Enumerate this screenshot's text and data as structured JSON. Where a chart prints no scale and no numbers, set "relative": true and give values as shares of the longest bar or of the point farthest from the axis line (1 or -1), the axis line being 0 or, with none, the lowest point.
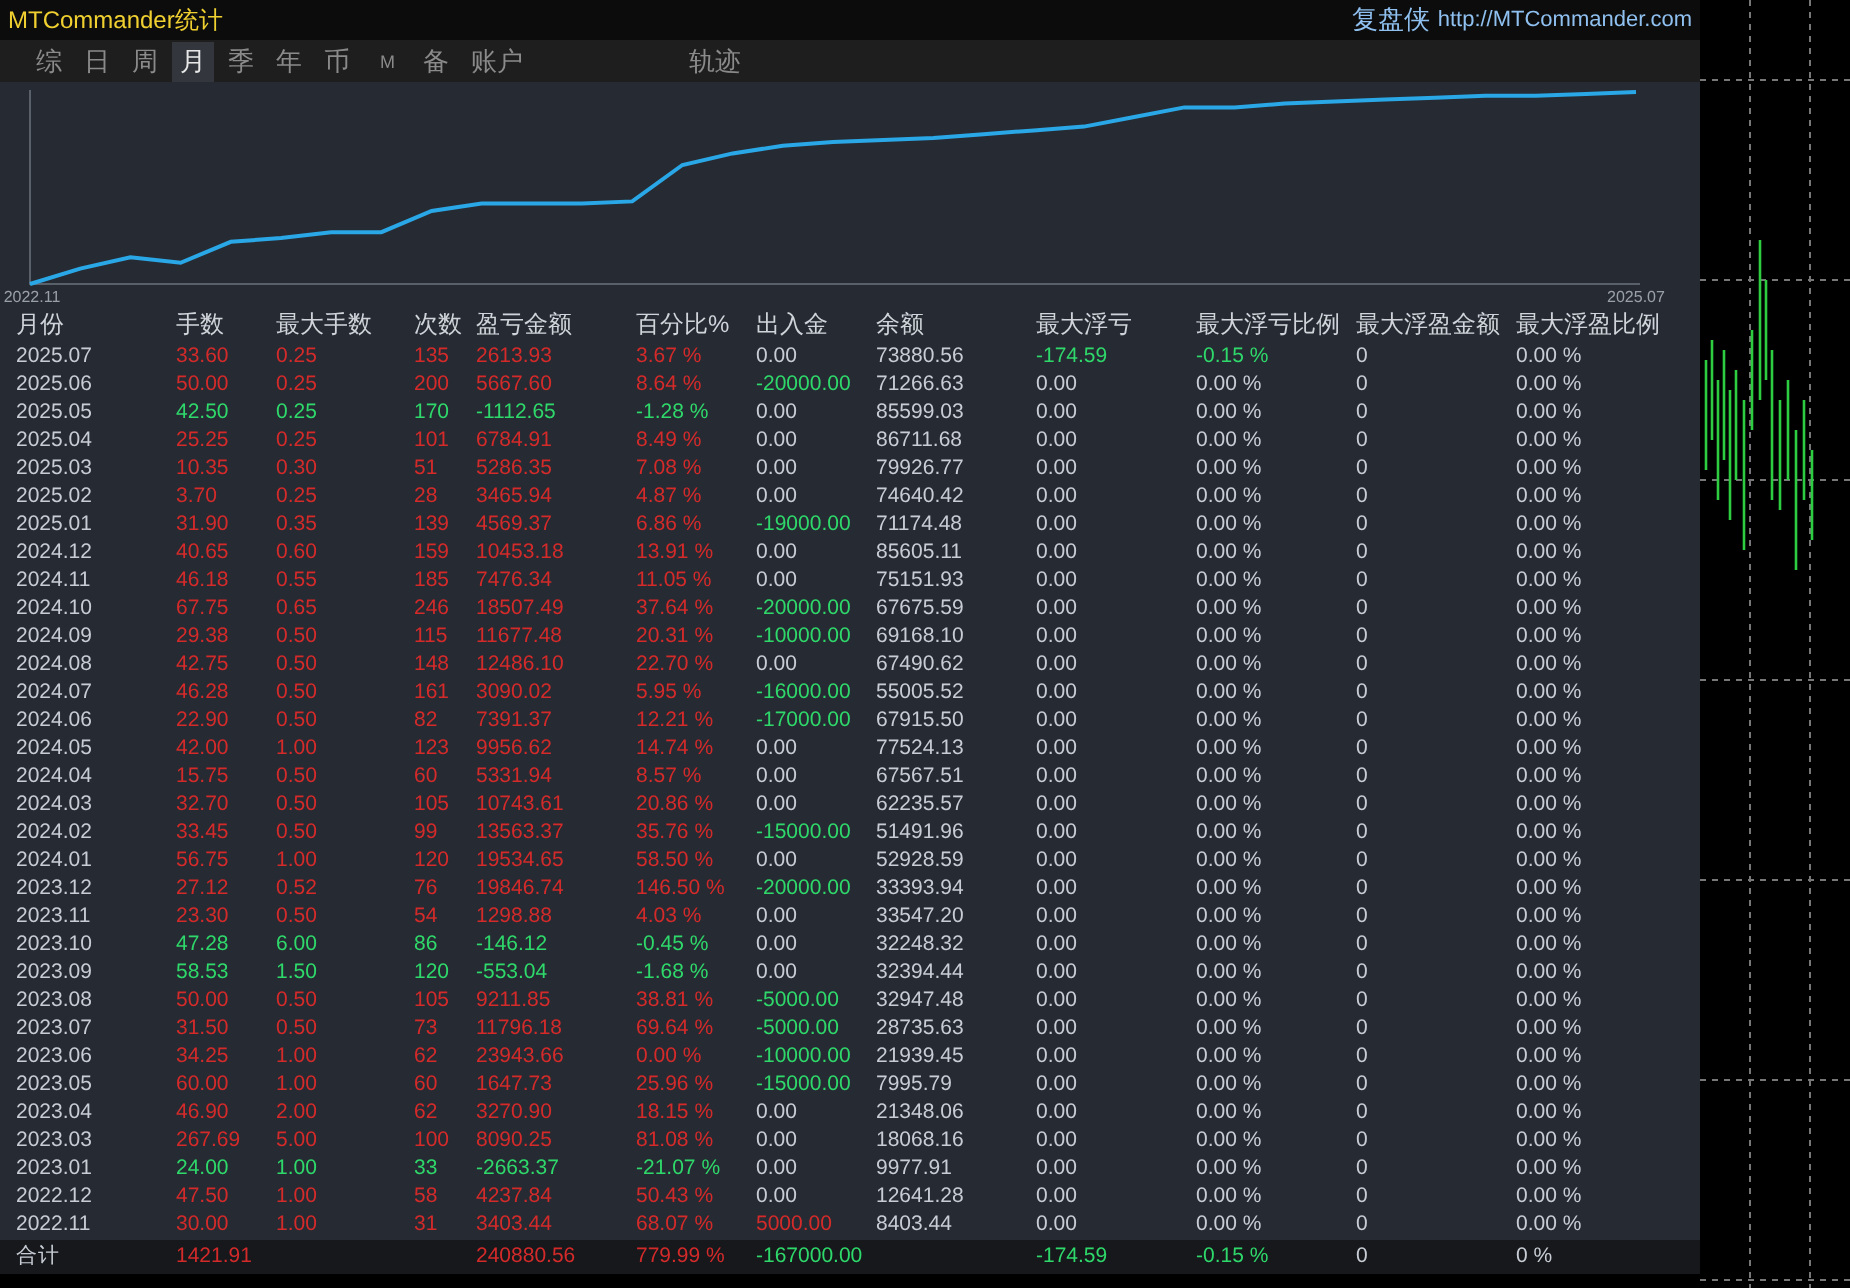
{
  "window": {
    "title": "MTCommander统计",
    "brand": "复盘侠",
    "link": "http://MTCommander.com"
  },
  "tabs": [
    {
      "label": "综",
      "selected": false,
      "kind": "char"
    },
    {
      "label": "日",
      "selected": false,
      "kind": "char"
    },
    {
      "label": "周",
      "selected": false,
      "kind": "char"
    },
    {
      "label": "月",
      "selected": true,
      "kind": "char"
    },
    {
      "label": "季",
      "selected": false,
      "kind": "char"
    },
    {
      "label": "年",
      "selected": false,
      "kind": "char"
    },
    {
      "label": "币",
      "selected": false,
      "kind": "char"
    },
    {
      "label": "M",
      "selected": false,
      "kind": "small"
    },
    {
      "label": "备",
      "selected": false,
      "kind": "char"
    },
    {
      "label": "账户",
      "selected": false,
      "kind": "char"
    },
    {
      "label": "轨迹",
      "selected": false,
      "kind": "far"
    }
  ],
  "equity_chart": {
    "chart_data": {
      "type": "line",
      "relative": true,
      "categories": [
        "2022.11",
        null,
        null,
        null,
        null,
        null,
        null,
        null,
        null,
        null,
        null,
        null,
        null,
        null,
        null,
        null,
        null,
        null,
        null,
        null,
        null,
        null,
        null,
        null,
        null,
        null,
        null,
        null,
        null,
        null,
        null,
        null,
        "2025.07"
      ],
      "series": [
        {
          "color": "#2aa7e6",
          "values": [
            0.0,
            0.08,
            0.14,
            0.11,
            0.22,
            0.24,
            0.27,
            0.27,
            0.38,
            0.42,
            0.42,
            0.42,
            0.43,
            0.62,
            0.68,
            0.72,
            0.74,
            0.75,
            0.76,
            0.78,
            0.8,
            0.82,
            0.87,
            0.92,
            0.92,
            0.94,
            0.95,
            0.96,
            0.97,
            0.98,
            0.98,
            0.99,
            1.0
          ]
        }
      ]
    }
  },
  "table": {
    "columns": [
      "月份",
      "手数",
      "最大手数",
      "次数",
      "盈亏金额",
      "百分比%",
      "出入金",
      "余额",
      "最大浮亏",
      "最大浮亏比例",
      "最大浮盈金额",
      "最大浮盈比例"
    ],
    "rows": [
      {
        "month": "2025.07",
        "trade": {
          "lots": "33.60",
          "max_lots": "0.25",
          "count": "135",
          "pnl": "2613.93",
          "pct": "3.67 %",
          "color": "#d42a2a"
        },
        "flow": {
          "amount": "0.00",
          "color": "#c8ccd4"
        },
        "balance": "73880.56",
        "drawdown": {
          "amount": "-174.59",
          "pct": "-0.15 %",
          "color": "#2fd86a"
        },
        "max_profit": "0",
        "max_profit_pct": "0.00 %"
      },
      {
        "month": "2025.06",
        "trade": {
          "lots": "50.00",
          "max_lots": "0.25",
          "count": "200",
          "pnl": "5667.60",
          "pct": "8.64 %",
          "color": "#d42a2a"
        },
        "flow": {
          "amount": "-20000.00",
          "color": "#2fd86a"
        },
        "balance": "71266.63",
        "drawdown": {
          "amount": "0.00",
          "pct": "0.00 %",
          "color": "#c8ccd4"
        },
        "max_profit": "0",
        "max_profit_pct": "0.00 %"
      },
      {
        "month": "2025.05",
        "trade": {
          "lots": "42.50",
          "max_lots": "0.25",
          "count": "170",
          "pnl": "-1112.65",
          "pct": "-1.28 %",
          "color": "#2fd86a"
        },
        "flow": {
          "amount": "0.00",
          "color": "#c8ccd4"
        },
        "balance": "85599.03",
        "drawdown": {
          "amount": "0.00",
          "pct": "0.00 %",
          "color": "#c8ccd4"
        },
        "max_profit": "0",
        "max_profit_pct": "0.00 %"
      },
      {
        "month": "2025.04",
        "trade": {
          "lots": "25.25",
          "max_lots": "0.25",
          "count": "101",
          "pnl": "6784.91",
          "pct": "8.49 %",
          "color": "#d42a2a"
        },
        "flow": {
          "amount": "0.00",
          "color": "#c8ccd4"
        },
        "balance": "86711.68",
        "drawdown": {
          "amount": "0.00",
          "pct": "0.00 %",
          "color": "#c8ccd4"
        },
        "max_profit": "0",
        "max_profit_pct": "0.00 %"
      },
      {
        "month": "2025.03",
        "trade": {
          "lots": "10.35",
          "max_lots": "0.30",
          "count": "51",
          "pnl": "5286.35",
          "pct": "7.08 %",
          "color": "#d42a2a"
        },
        "flow": {
          "amount": "0.00",
          "color": "#c8ccd4"
        },
        "balance": "79926.77",
        "drawdown": {
          "amount": "0.00",
          "pct": "0.00 %",
          "color": "#c8ccd4"
        },
        "max_profit": "0",
        "max_profit_pct": "0.00 %"
      },
      {
        "month": "2025.02",
        "trade": {
          "lots": "3.70",
          "max_lots": "0.25",
          "count": "28",
          "pnl": "3465.94",
          "pct": "4.87 %",
          "color": "#d42a2a"
        },
        "flow": {
          "amount": "0.00",
          "color": "#c8ccd4"
        },
        "balance": "74640.42",
        "drawdown": {
          "amount": "0.00",
          "pct": "0.00 %",
          "color": "#c8ccd4"
        },
        "max_profit": "0",
        "max_profit_pct": "0.00 %"
      },
      {
        "month": "2025.01",
        "trade": {
          "lots": "31.90",
          "max_lots": "0.35",
          "count": "139",
          "pnl": "4569.37",
          "pct": "6.86 %",
          "color": "#d42a2a"
        },
        "flow": {
          "amount": "-19000.00",
          "color": "#2fd86a"
        },
        "balance": "71174.48",
        "drawdown": {
          "amount": "0.00",
          "pct": "0.00 %",
          "color": "#c8ccd4"
        },
        "max_profit": "0",
        "max_profit_pct": "0.00 %"
      },
      {
        "month": "2024.12",
        "trade": {
          "lots": "40.65",
          "max_lots": "0.60",
          "count": "159",
          "pnl": "10453.18",
          "pct": "13.91 %",
          "color": "#d42a2a"
        },
        "flow": {
          "amount": "0.00",
          "color": "#c8ccd4"
        },
        "balance": "85605.11",
        "drawdown": {
          "amount": "0.00",
          "pct": "0.00 %",
          "color": "#c8ccd4"
        },
        "max_profit": "0",
        "max_profit_pct": "0.00 %"
      },
      {
        "month": "2024.11",
        "trade": {
          "lots": "46.18",
          "max_lots": "0.55",
          "count": "185",
          "pnl": "7476.34",
          "pct": "11.05 %",
          "color": "#d42a2a"
        },
        "flow": {
          "amount": "0.00",
          "color": "#c8ccd4"
        },
        "balance": "75151.93",
        "drawdown": {
          "amount": "0.00",
          "pct": "0.00 %",
          "color": "#c8ccd4"
        },
        "max_profit": "0",
        "max_profit_pct": "0.00 %"
      },
      {
        "month": "2024.10",
        "trade": {
          "lots": "67.75",
          "max_lots": "0.65",
          "count": "246",
          "pnl": "18507.49",
          "pct": "37.64 %",
          "color": "#d42a2a"
        },
        "flow": {
          "amount": "-20000.00",
          "color": "#2fd86a"
        },
        "balance": "67675.59",
        "drawdown": {
          "amount": "0.00",
          "pct": "0.00 %",
          "color": "#c8ccd4"
        },
        "max_profit": "0",
        "max_profit_pct": "0.00 %"
      },
      {
        "month": "2024.09",
        "trade": {
          "lots": "29.38",
          "max_lots": "0.50",
          "count": "115",
          "pnl": "11677.48",
          "pct": "20.31 %",
          "color": "#d42a2a"
        },
        "flow": {
          "amount": "-10000.00",
          "color": "#2fd86a"
        },
        "balance": "69168.10",
        "drawdown": {
          "amount": "0.00",
          "pct": "0.00 %",
          "color": "#c8ccd4"
        },
        "max_profit": "0",
        "max_profit_pct": "0.00 %"
      },
      {
        "month": "2024.08",
        "trade": {
          "lots": "42.75",
          "max_lots": "0.50",
          "count": "148",
          "pnl": "12486.10",
          "pct": "22.70 %",
          "color": "#d42a2a"
        },
        "flow": {
          "amount": "0.00",
          "color": "#c8ccd4"
        },
        "balance": "67490.62",
        "drawdown": {
          "amount": "0.00",
          "pct": "0.00 %",
          "color": "#c8ccd4"
        },
        "max_profit": "0",
        "max_profit_pct": "0.00 %"
      },
      {
        "month": "2024.07",
        "trade": {
          "lots": "46.28",
          "max_lots": "0.50",
          "count": "161",
          "pnl": "3090.02",
          "pct": "5.95 %",
          "color": "#d42a2a"
        },
        "flow": {
          "amount": "-16000.00",
          "color": "#2fd86a"
        },
        "balance": "55005.52",
        "drawdown": {
          "amount": "0.00",
          "pct": "0.00 %",
          "color": "#c8ccd4"
        },
        "max_profit": "0",
        "max_profit_pct": "0.00 %"
      },
      {
        "month": "2024.06",
        "trade": {
          "lots": "22.90",
          "max_lots": "0.50",
          "count": "82",
          "pnl": "7391.37",
          "pct": "12.21 %",
          "color": "#d42a2a"
        },
        "flow": {
          "amount": "-17000.00",
          "color": "#2fd86a"
        },
        "balance": "67915.50",
        "drawdown": {
          "amount": "0.00",
          "pct": "0.00 %",
          "color": "#c8ccd4"
        },
        "max_profit": "0",
        "max_profit_pct": "0.00 %"
      },
      {
        "month": "2024.05",
        "trade": {
          "lots": "42.00",
          "max_lots": "1.00",
          "count": "123",
          "pnl": "9956.62",
          "pct": "14.74 %",
          "color": "#d42a2a"
        },
        "flow": {
          "amount": "0.00",
          "color": "#c8ccd4"
        },
        "balance": "77524.13",
        "drawdown": {
          "amount": "0.00",
          "pct": "0.00 %",
          "color": "#c8ccd4"
        },
        "max_profit": "0",
        "max_profit_pct": "0.00 %"
      },
      {
        "month": "2024.04",
        "trade": {
          "lots": "15.75",
          "max_lots": "0.50",
          "count": "60",
          "pnl": "5331.94",
          "pct": "8.57 %",
          "color": "#d42a2a"
        },
        "flow": {
          "amount": "0.00",
          "color": "#c8ccd4"
        },
        "balance": "67567.51",
        "drawdown": {
          "amount": "0.00",
          "pct": "0.00 %",
          "color": "#c8ccd4"
        },
        "max_profit": "0",
        "max_profit_pct": "0.00 %"
      },
      {
        "month": "2024.03",
        "trade": {
          "lots": "32.70",
          "max_lots": "0.50",
          "count": "105",
          "pnl": "10743.61",
          "pct": "20.86 %",
          "color": "#d42a2a"
        },
        "flow": {
          "amount": "0.00",
          "color": "#c8ccd4"
        },
        "balance": "62235.57",
        "drawdown": {
          "amount": "0.00",
          "pct": "0.00 %",
          "color": "#c8ccd4"
        },
        "max_profit": "0",
        "max_profit_pct": "0.00 %"
      },
      {
        "month": "2024.02",
        "trade": {
          "lots": "33.45",
          "max_lots": "0.50",
          "count": "99",
          "pnl": "13563.37",
          "pct": "35.76 %",
          "color": "#d42a2a"
        },
        "flow": {
          "amount": "-15000.00",
          "color": "#2fd86a"
        },
        "balance": "51491.96",
        "drawdown": {
          "amount": "0.00",
          "pct": "0.00 %",
          "color": "#c8ccd4"
        },
        "max_profit": "0",
        "max_profit_pct": "0.00 %"
      },
      {
        "month": "2024.01",
        "trade": {
          "lots": "56.75",
          "max_lots": "1.00",
          "count": "120",
          "pnl": "19534.65",
          "pct": "58.50 %",
          "color": "#d42a2a"
        },
        "flow": {
          "amount": "0.00",
          "color": "#c8ccd4"
        },
        "balance": "52928.59",
        "drawdown": {
          "amount": "0.00",
          "pct": "0.00 %",
          "color": "#c8ccd4"
        },
        "max_profit": "0",
        "max_profit_pct": "0.00 %"
      },
      {
        "month": "2023.12",
        "trade": {
          "lots": "27.12",
          "max_lots": "0.52",
          "count": "76",
          "pnl": "19846.74",
          "pct": "146.50 %",
          "color": "#d42a2a"
        },
        "flow": {
          "amount": "-20000.00",
          "color": "#2fd86a"
        },
        "balance": "33393.94",
        "drawdown": {
          "amount": "0.00",
          "pct": "0.00 %",
          "color": "#c8ccd4"
        },
        "max_profit": "0",
        "max_profit_pct": "0.00 %"
      },
      {
        "month": "2023.11",
        "trade": {
          "lots": "23.30",
          "max_lots": "0.50",
          "count": "54",
          "pnl": "1298.88",
          "pct": "4.03 %",
          "color": "#d42a2a"
        },
        "flow": {
          "amount": "0.00",
          "color": "#c8ccd4"
        },
        "balance": "33547.20",
        "drawdown": {
          "amount": "0.00",
          "pct": "0.00 %",
          "color": "#c8ccd4"
        },
        "max_profit": "0",
        "max_profit_pct": "0.00 %"
      },
      {
        "month": "2023.10",
        "trade": {
          "lots": "47.28",
          "max_lots": "6.00",
          "count": "86",
          "pnl": "-146.12",
          "pct": "-0.45 %",
          "color": "#2fd86a"
        },
        "flow": {
          "amount": "0.00",
          "color": "#c8ccd4"
        },
        "balance": "32248.32",
        "drawdown": {
          "amount": "0.00",
          "pct": "0.00 %",
          "color": "#c8ccd4"
        },
        "max_profit": "0",
        "max_profit_pct": "0.00 %"
      },
      {
        "month": "2023.09",
        "trade": {
          "lots": "58.53",
          "max_lots": "1.50",
          "count": "120",
          "pnl": "-553.04",
          "pct": "-1.68 %",
          "color": "#2fd86a"
        },
        "flow": {
          "amount": "0.00",
          "color": "#c8ccd4"
        },
        "balance": "32394.44",
        "drawdown": {
          "amount": "0.00",
          "pct": "0.00 %",
          "color": "#c8ccd4"
        },
        "max_profit": "0",
        "max_profit_pct": "0.00 %"
      },
      {
        "month": "2023.08",
        "trade": {
          "lots": "50.00",
          "max_lots": "0.50",
          "count": "105",
          "pnl": "9211.85",
          "pct": "38.81 %",
          "color": "#d42a2a"
        },
        "flow": {
          "amount": "-5000.00",
          "color": "#2fd86a"
        },
        "balance": "32947.48",
        "drawdown": {
          "amount": "0.00",
          "pct": "0.00 %",
          "color": "#c8ccd4"
        },
        "max_profit": "0",
        "max_profit_pct": "0.00 %"
      },
      {
        "month": "2023.07",
        "trade": {
          "lots": "31.50",
          "max_lots": "0.50",
          "count": "73",
          "pnl": "11796.18",
          "pct": "69.64 %",
          "color": "#d42a2a"
        },
        "flow": {
          "amount": "-5000.00",
          "color": "#2fd86a"
        },
        "balance": "28735.63",
        "drawdown": {
          "amount": "0.00",
          "pct": "0.00 %",
          "color": "#c8ccd4"
        },
        "max_profit": "0",
        "max_profit_pct": "0.00 %"
      },
      {
        "month": "2023.06",
        "trade": {
          "lots": "34.25",
          "max_lots": "1.00",
          "count": "62",
          "pnl": "23943.66",
          "pct": "0.00 %",
          "color": "#d42a2a"
        },
        "flow": {
          "amount": "-10000.00",
          "color": "#2fd86a"
        },
        "balance": "21939.45",
        "drawdown": {
          "amount": "0.00",
          "pct": "0.00 %",
          "color": "#c8ccd4"
        },
        "max_profit": "0",
        "max_profit_pct": "0.00 %"
      },
      {
        "month": "2023.05",
        "trade": {
          "lots": "60.00",
          "max_lots": "1.00",
          "count": "60",
          "pnl": "1647.73",
          "pct": "25.96 %",
          "color": "#d42a2a"
        },
        "flow": {
          "amount": "-15000.00",
          "color": "#2fd86a"
        },
        "balance": "7995.79",
        "drawdown": {
          "amount": "0.00",
          "pct": "0.00 %",
          "color": "#c8ccd4"
        },
        "max_profit": "0",
        "max_profit_pct": "0.00 %"
      },
      {
        "month": "2023.04",
        "trade": {
          "lots": "46.90",
          "max_lots": "2.00",
          "count": "62",
          "pnl": "3270.90",
          "pct": "18.15 %",
          "color": "#d42a2a"
        },
        "flow": {
          "amount": "0.00",
          "color": "#c8ccd4"
        },
        "balance": "21348.06",
        "drawdown": {
          "amount": "0.00",
          "pct": "0.00 %",
          "color": "#c8ccd4"
        },
        "max_profit": "0",
        "max_profit_pct": "0.00 %"
      },
      {
        "month": "2023.03",
        "trade": {
          "lots": "267.69",
          "max_lots": "5.00",
          "count": "100",
          "pnl": "8090.25",
          "pct": "81.08 %",
          "color": "#d42a2a"
        },
        "flow": {
          "amount": "0.00",
          "color": "#c8ccd4"
        },
        "balance": "18068.16",
        "drawdown": {
          "amount": "0.00",
          "pct": "0.00 %",
          "color": "#c8ccd4"
        },
        "max_profit": "0",
        "max_profit_pct": "0.00 %"
      },
      {
        "month": "2023.01",
        "trade": {
          "lots": "24.00",
          "max_lots": "1.00",
          "count": "33",
          "pnl": "-2663.37",
          "pct": "-21.07 %",
          "color": "#2fd86a"
        },
        "flow": {
          "amount": "0.00",
          "color": "#c8ccd4"
        },
        "balance": "9977.91",
        "drawdown": {
          "amount": "0.00",
          "pct": "0.00 %",
          "color": "#c8ccd4"
        },
        "max_profit": "0",
        "max_profit_pct": "0.00 %"
      },
      {
        "month": "2022.12",
        "trade": {
          "lots": "47.50",
          "max_lots": "1.00",
          "count": "58",
          "pnl": "4237.84",
          "pct": "50.43 %",
          "color": "#d42a2a"
        },
        "flow": {
          "amount": "0.00",
          "color": "#c8ccd4"
        },
        "balance": "12641.28",
        "drawdown": {
          "amount": "0.00",
          "pct": "0.00 %",
          "color": "#c8ccd4"
        },
        "max_profit": "0",
        "max_profit_pct": "0.00 %"
      },
      {
        "month": "2022.11",
        "trade": {
          "lots": "30.00",
          "max_lots": "1.00",
          "count": "31",
          "pnl": "3403.44",
          "pct": "68.07 %",
          "color": "#d42a2a"
        },
        "flow": {
          "amount": "5000.00",
          "color": "#d42a2a"
        },
        "balance": "8403.44",
        "drawdown": {
          "amount": "0.00",
          "pct": "0.00 %",
          "color": "#c8ccd4"
        },
        "max_profit": "0",
        "max_profit_pct": "0.00 %"
      }
    ],
    "total": {
      "label": "合计",
      "trade": {
        "lots": "1421.91",
        "pnl": "240880.56",
        "pct": "779.99 %",
        "color": "#d42a2a"
      },
      "flow": {
        "amount": "-167000.00",
        "color": "#2fd86a"
      },
      "drawdown": {
        "amount": "-174.59",
        "pct": "-0.15 %",
        "color": "#2fd86a"
      },
      "max_profit": "0",
      "max_profit_pct": "0 %"
    }
  }
}
